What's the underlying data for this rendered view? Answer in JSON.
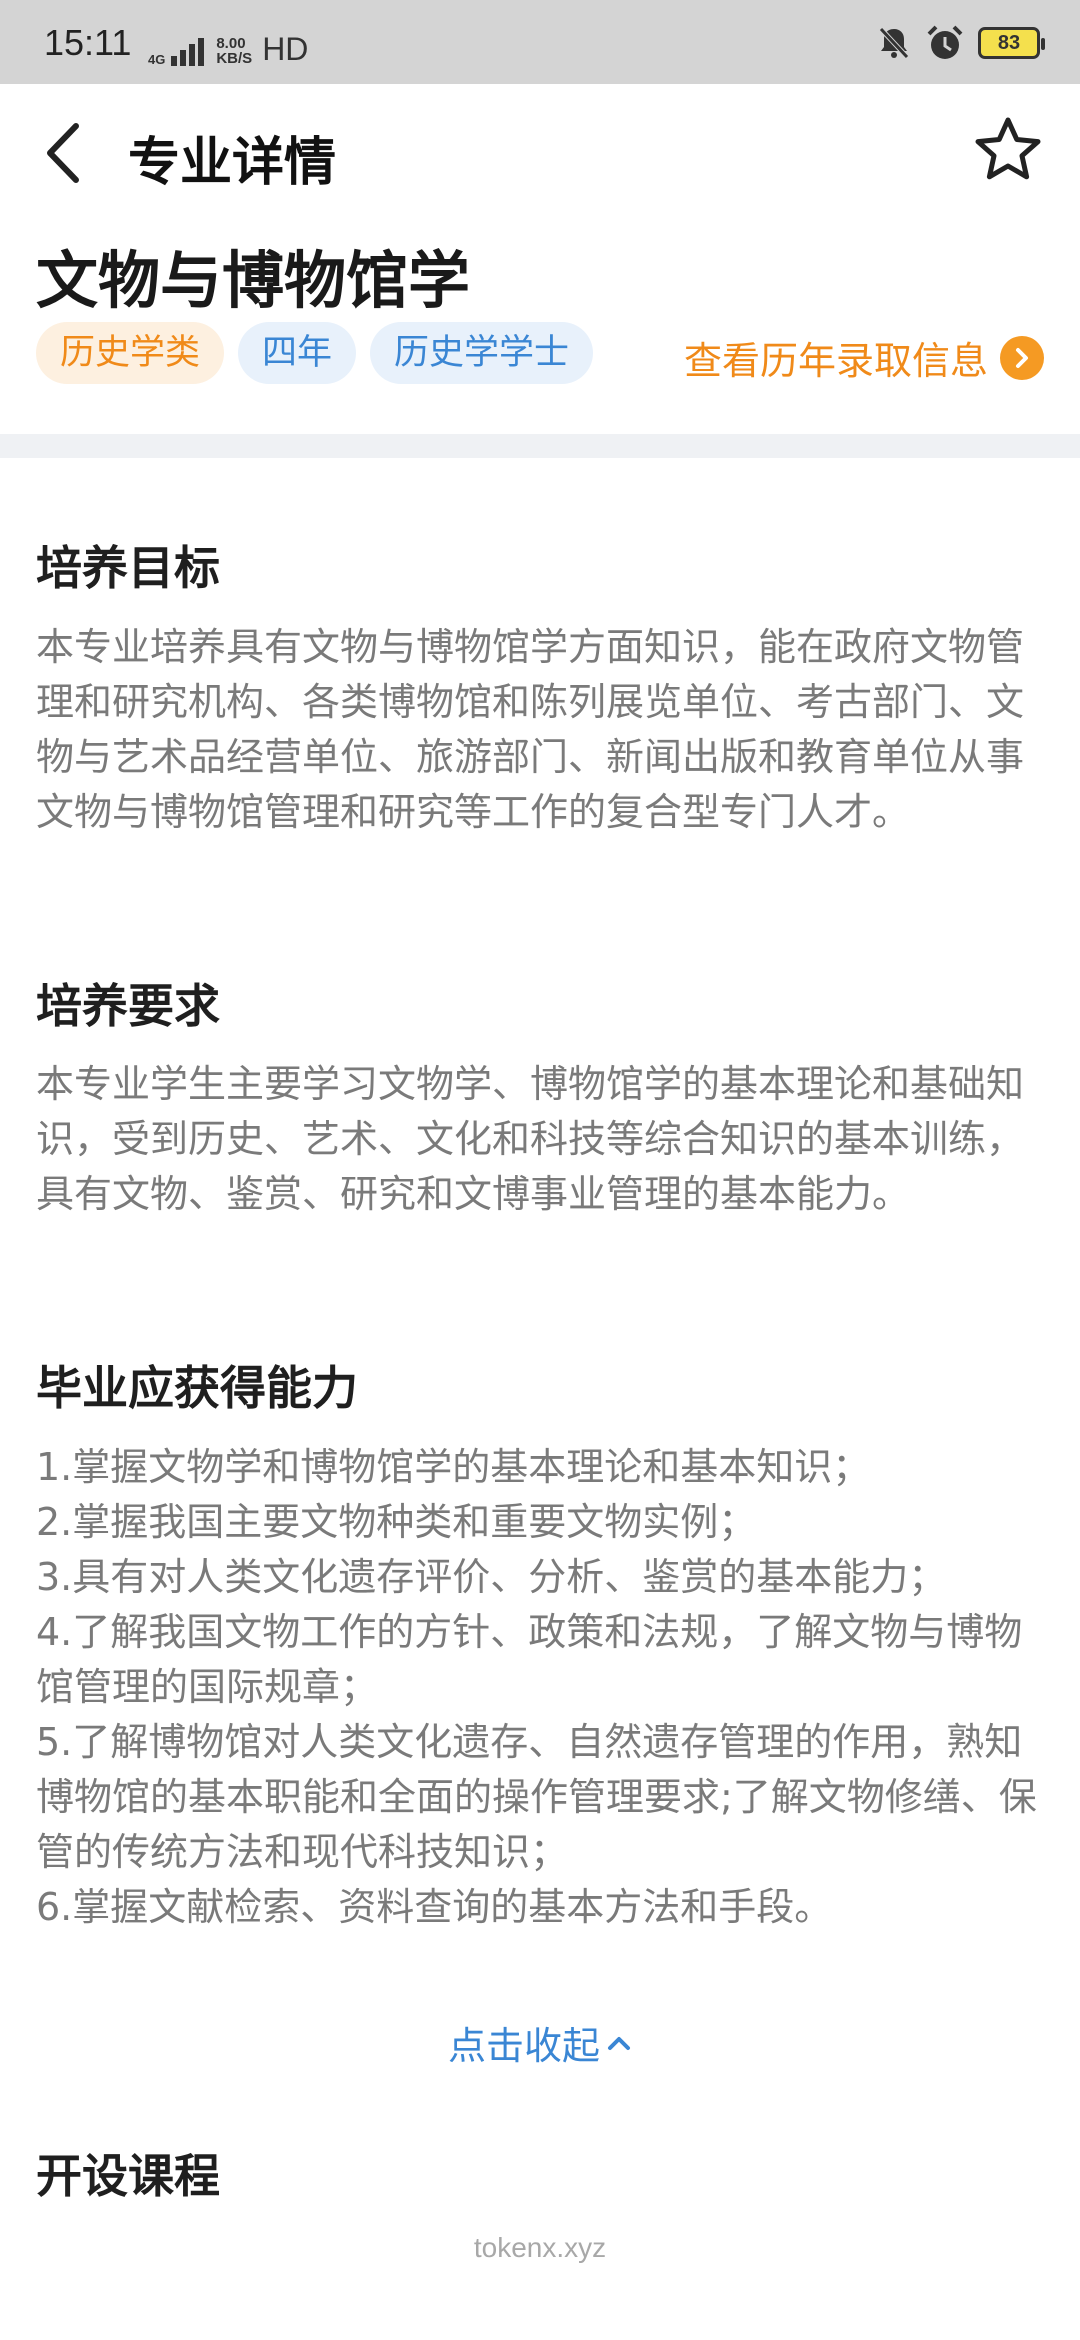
{
  "status_bar": {
    "time": "15:11",
    "network": "4G",
    "speed_value": "8.00",
    "speed_unit": "KB/S",
    "hd": "HD",
    "battery": "83",
    "icons": [
      "bell-muted-icon",
      "alarm-icon",
      "battery-icon"
    ]
  },
  "nav": {
    "title": "专业详情",
    "back_icon": "chevron-left-icon",
    "favorite_icon": "star-outline-icon"
  },
  "major": {
    "name": "文物与博物馆学",
    "tags": [
      "历史学类",
      "四年",
      "历史学学士"
    ],
    "history_link": "查看历年录取信息",
    "colors": {
      "orange": "#f08a19",
      "blue": "#3a86d4"
    }
  },
  "sections": {
    "goal": {
      "title": "培养目标",
      "body": "本专业培养具有文物与博物馆学方面知识，能在政府文物管理和研究机构、各类博物馆和陈列展览单位、考古部门、文物与艺术品经营单位、旅游部门、新闻出版和教育单位从事文物与博物馆管理和研究等工作的复合型专门人才。"
    },
    "requirement": {
      "title": "培养要求",
      "body": "本专业学生主要学习文物学、博物馆学的基本理论和基础知识，受到历史、艺术、文化和科技等综合知识的基本训练，具有文物、鉴赏、研究和文博事业管理的基本能力。"
    },
    "abilities": {
      "title": "毕业应获得能力",
      "items": [
        "1.掌握文物学和博物馆学的基本理论和基本知识；",
        "2.掌握我国主要文物种类和重要文物实例；",
        "3.具有对人类文化遗存评价、分析、鉴赏的基本能力；",
        "4.了解我国文物工作的方针、政策和法规，了解文物与博物馆管理的国际规章；",
        "5.了解博物馆对人类文化遗存、自然遗存管理的作用，熟知博物馆的基本职能和全面的操作管理要求;了解文物修缮、保管的传统方法和现代科技知识；",
        "6.掌握文献检索、资料查询的基本方法和手段。"
      ],
      "collapse_label": "点击收起"
    },
    "courses": {
      "title": "开设课程"
    }
  },
  "watermark": "tokenx.xyz"
}
